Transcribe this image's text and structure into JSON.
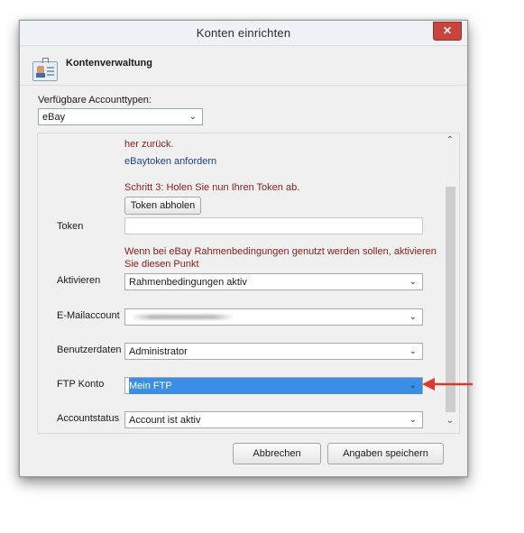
{
  "dialog": {
    "title": "Konten einrichten",
    "close_glyph": "✕"
  },
  "header": {
    "title": "Kontenverwaltung",
    "icon": "id-card-icon"
  },
  "account_types": {
    "label": "Verfügbare Accounttypen:",
    "selected": "eBay"
  },
  "panel": {
    "text_back": "her zurück.",
    "link_token": "eBaytoken anfordern",
    "step3": "Schritt 3: Holen Sie nun Ihren Token ab.",
    "fetch_button": "Token abholen",
    "token_label": "Token",
    "token_value": "",
    "framework_note_line1": "Wenn bei eBay Rahmenbedingungen genutzt werden sollen, aktivieren",
    "framework_note_line2": "Sie diesen Punkt",
    "rows": {
      "activate": {
        "label": "Aktivieren",
        "value": "Rahmenbedingungen aktiv"
      },
      "email": {
        "label": "E-Mailaccount",
        "value": ""
      },
      "userdata": {
        "label": "Benutzerdaten",
        "value": "Administrator"
      },
      "ftp": {
        "label": "FTP Konto",
        "value": "Mein FTP"
      },
      "status": {
        "label": "Accountstatus",
        "value": "Account ist aktiv"
      }
    }
  },
  "footer": {
    "cancel": "Abbrechen",
    "save": "Angaben speichern"
  },
  "colors": {
    "close_button": "#c9443d",
    "note_text": "#8b1a1a",
    "link_text": "#1f3f8f",
    "selection": "#3399ff",
    "annotation_arrow": "#d93a2b"
  }
}
